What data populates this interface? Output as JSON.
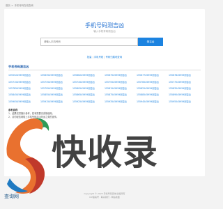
{
  "breadcrumb": {
    "items": [
      "首页",
      "手机号码在线查询"
    ]
  },
  "header": {
    "title": "手机号码测吉凶",
    "subtitle": "输入手机号码测吉凶"
  },
  "search": {
    "placeholder": "请输入手机号码",
    "button_label": "测吉凶"
  },
  "helper_links": [
    "批量",
    "手机号段",
    "号码归属地查询"
  ],
  "section": {
    "title": "手机号码测吉凶"
  },
  "number_grid": [
    [
      "15555245959测吉凶",
      "15563545959测吉凶",
      "15566245959测吉凶",
      "15567545959测吉凶",
      "15567745959测吉凶",
      "15567845959测吉凶"
    ],
    [
      "15571545959测吉凶",
      "15573545959测吉凶",
      "15574545959测吉凶",
      "15575545959测吉凶",
      "15576545959测吉凶",
      "15577545959测吉凶"
    ],
    [
      "15578545959测吉凶",
      "15579545959测吉凶",
      "15580545959测吉凶",
      "15581545959测吉凶",
      "15582545959测吉凶",
      "15583545959测吉凶"
    ],
    [
      "15584545959测吉凶",
      "15585545959测吉凶",
      "15586545959测吉凶",
      "15587545959测吉凶",
      "15588545959测吉凶",
      "15589545959测吉凶"
    ],
    [
      "15590545959测吉凶",
      "15591545959测吉凶",
      "15592545959测吉凶",
      "15593545959测吉凶",
      "15594545959测吉凶",
      "15595545959测吉凶"
    ]
  ],
  "notes": {
    "heading": "参考说明：",
    "lines": [
      "1、结果仅供娱乐参考，若有需要请谨慎使用。",
      "2、请勿轻信网络上手机号码吉凶改运之类的宣传。"
    ]
  },
  "watermark": {
    "text": "快收录",
    "caption": "查询网"
  },
  "footer": {
    "lines": [
      "Copyright © 2023 手机号码查询 版权所有",
      "ICP备案号 · 联系我们 · 网站地图"
    ]
  }
}
